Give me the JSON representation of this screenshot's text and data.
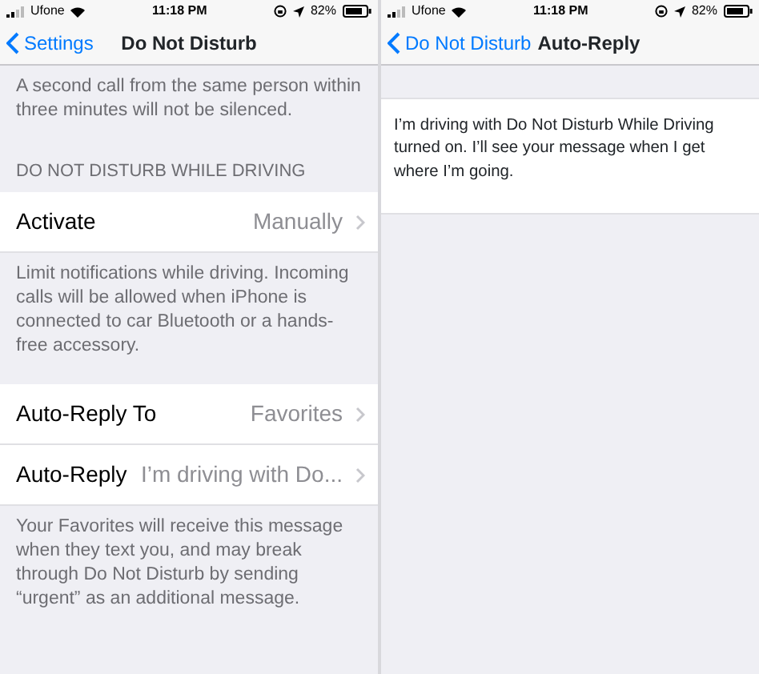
{
  "screens": [
    {
      "status_bar": {
        "carrier": "Ufone",
        "time": "11:18 PM",
        "battery": "82%"
      },
      "nav": {
        "back": "Settings",
        "title": "Do Not Disturb"
      },
      "content": [
        {
          "kind": "note",
          "text": "A second call from the same person within three minutes will not be silenced."
        },
        {
          "kind": "header",
          "text": "DO NOT DISTURB WHILE DRIVING"
        },
        {
          "kind": "row",
          "label": "Activate",
          "value": "Manually"
        },
        {
          "kind": "note",
          "text": "Limit notifications while driving. Incoming calls will be allowed when iPhone is connected to car Bluetooth or a hands-free accessory."
        },
        {
          "kind": "row",
          "label": "Auto-Reply To",
          "value": "Favorites"
        },
        {
          "kind": "row",
          "label": "Auto-Reply",
          "value": "I’m driving with Do..."
        },
        {
          "kind": "note",
          "text": "Your Favorites will receive this message when they text you, and may break through Do Not Disturb by sending “urgent” as an additional message."
        }
      ]
    },
    {
      "status_bar": {
        "carrier": "Ufone",
        "time": "11:18 PM",
        "battery": "82%"
      },
      "nav": {
        "back": "Do Not Disturb",
        "title": "Auto-Reply"
      },
      "content": [
        {
          "kind": "message",
          "text": "I’m driving with Do Not Disturb While Driving turned on. I’ll see your message when I get where I’m going."
        }
      ]
    }
  ]
}
